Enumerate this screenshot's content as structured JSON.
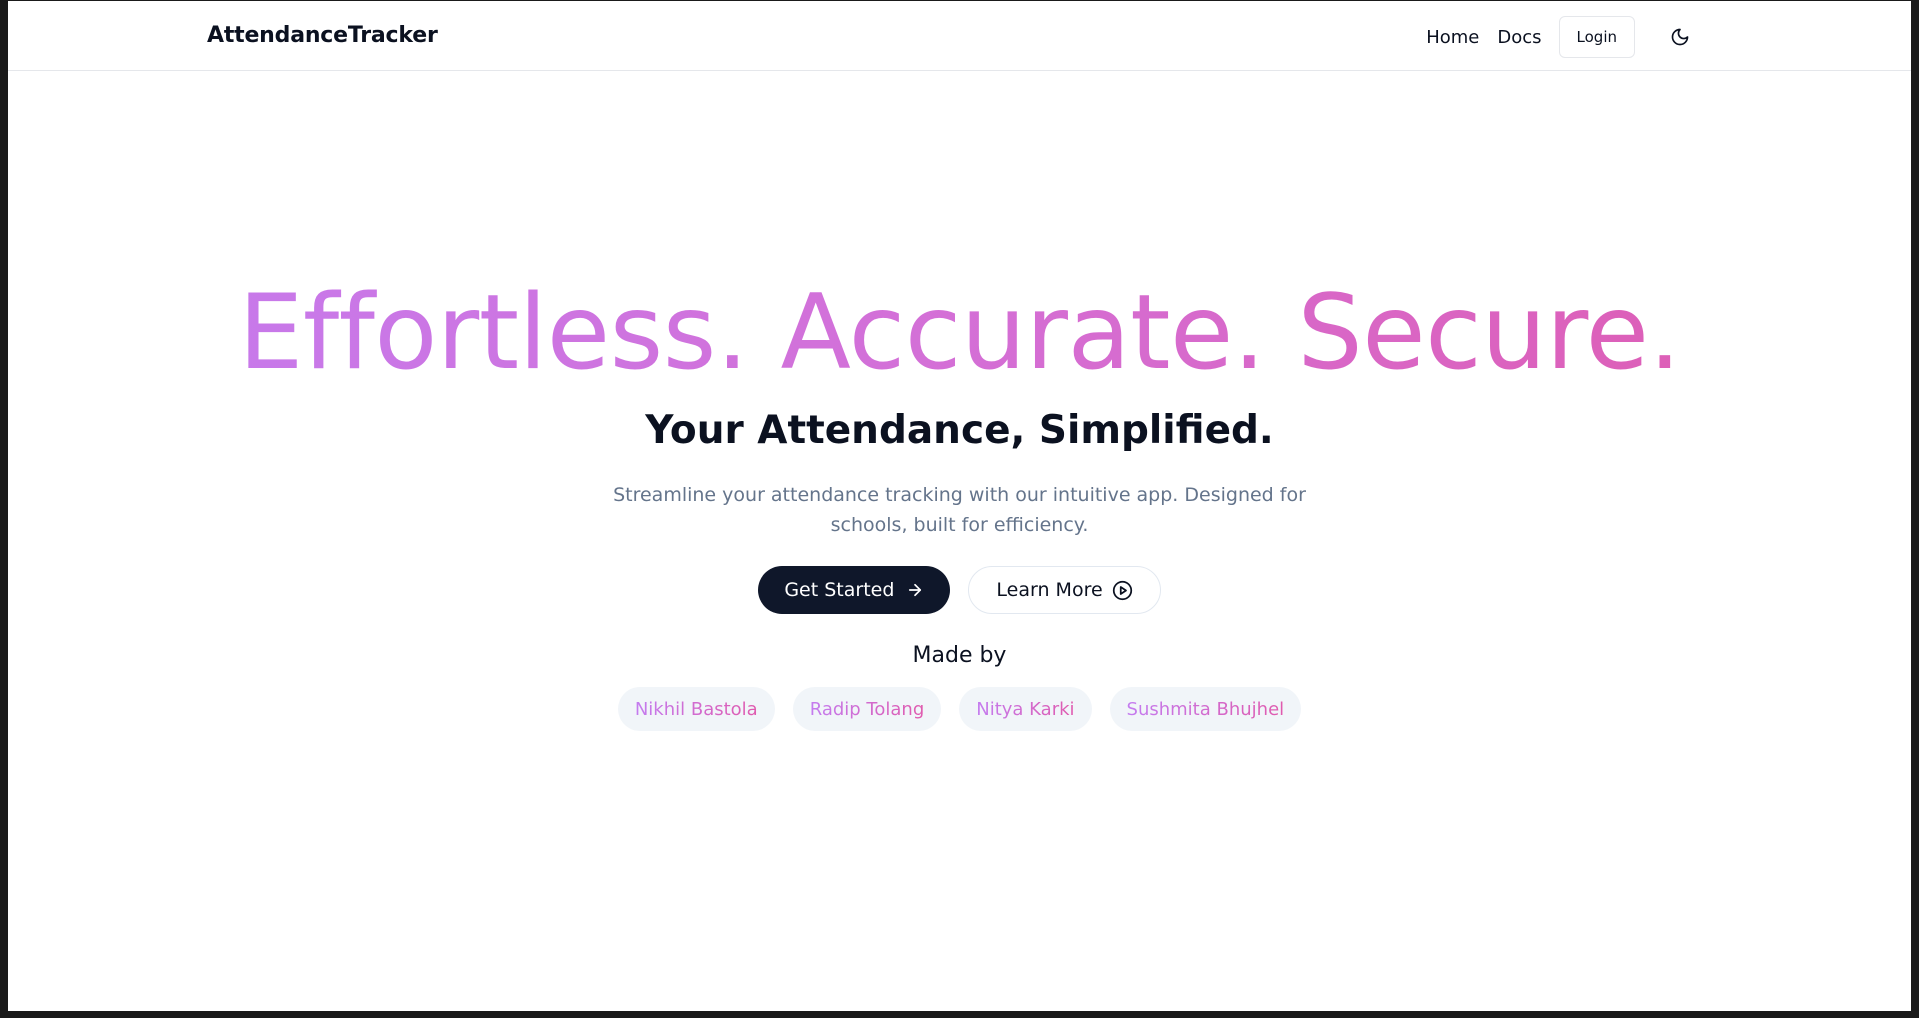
{
  "navbar": {
    "brand": "AttendanceTracker",
    "links": [
      {
        "label": "Home"
      },
      {
        "label": "Docs"
      }
    ],
    "login_label": "Login",
    "theme_toggle_icon": "moon-icon"
  },
  "hero": {
    "headline": "Effortless. Accurate. Secure.",
    "subheadline": "Your Attendance, Simplified.",
    "description": "Streamline your attendance tracking with our intuitive app. Designed for schools, built for efficiency.",
    "primary_button": {
      "label": "Get Started",
      "icon": "arrow-right-icon"
    },
    "secondary_button": {
      "label": "Learn More",
      "icon": "play-circle-icon"
    },
    "made_by_label": "Made by",
    "contributors": [
      "Nikhil Bastola",
      "Radip Tolang",
      "Nitya Karki",
      "Sushmita Bhujhel"
    ]
  },
  "colors": {
    "gradient_start": "#c47cf0",
    "gradient_end": "#e05aae",
    "primary_button_bg": "#0f172a",
    "muted_text": "#64748b",
    "chip_bg": "#f1f5f9"
  }
}
